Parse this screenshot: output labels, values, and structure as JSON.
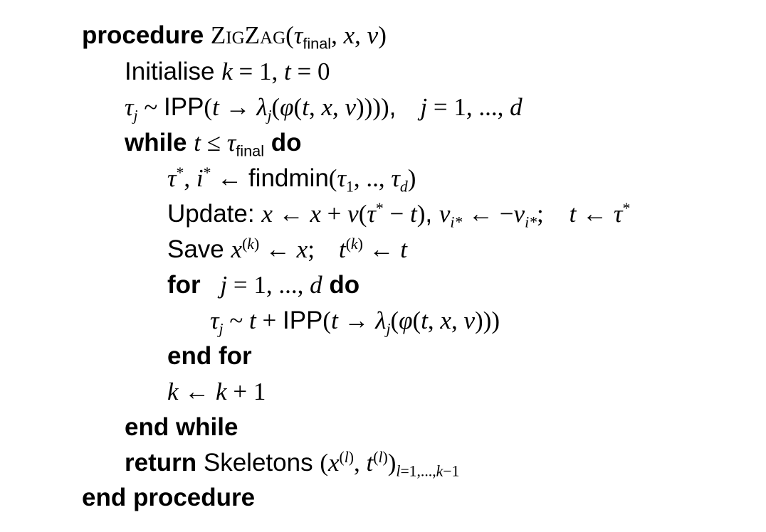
{
  "algorithm": {
    "kw_procedure": "procedure",
    "proc_name": "ZigZag",
    "kw_initialise": "Initialise",
    "kw_while": "while",
    "kw_do": "do",
    "fn_findmin": "findmin",
    "kw_update": "Update:",
    "kw_save": "Save",
    "kw_for": "for",
    "fn_ipp": "IPP",
    "kw_end_for": "end for",
    "kw_end_while": "end while",
    "kw_return": "return",
    "kw_skeletons": "Skeletons",
    "kw_end_procedure": "end procedure",
    "sub_final": "final"
  }
}
